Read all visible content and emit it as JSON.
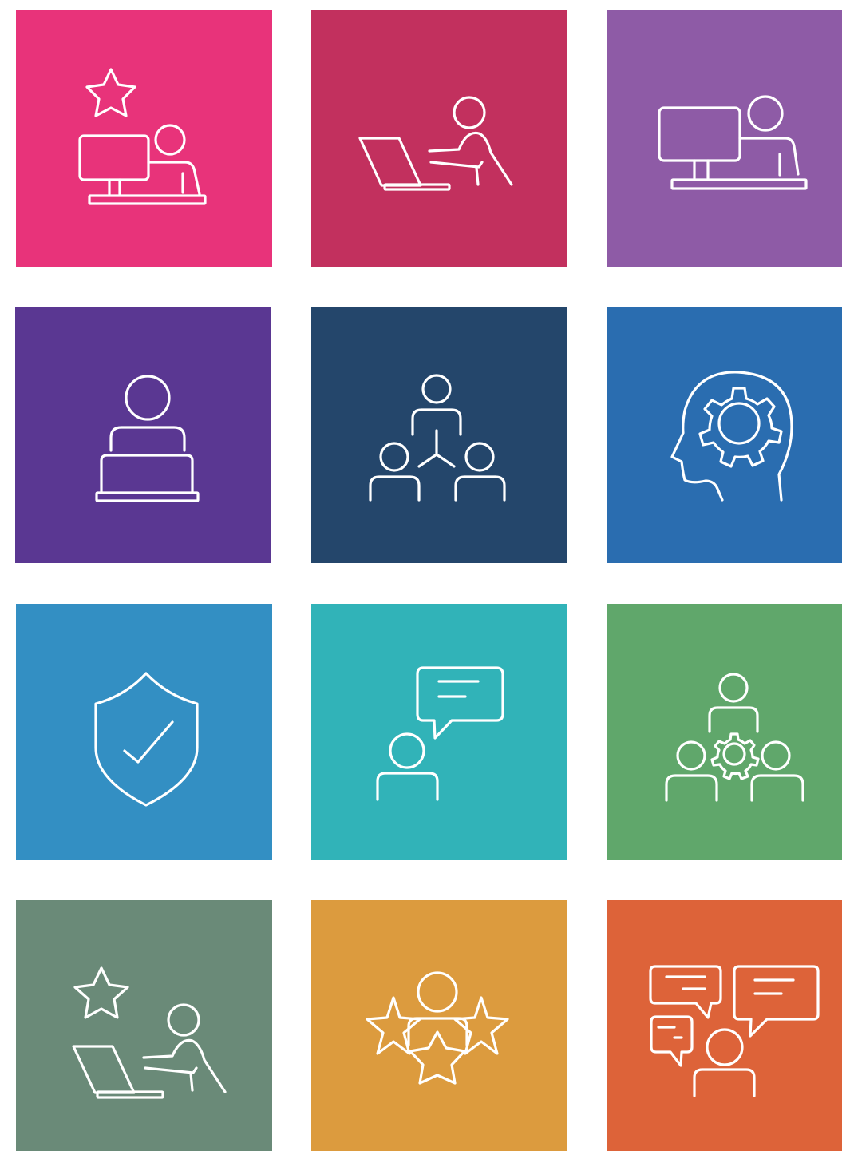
{
  "tiles": [
    {
      "icon": "person-at-desktop-with-star-icon",
      "color": "#E8337A"
    },
    {
      "icon": "person-at-laptop-icon",
      "color": "#C2305E"
    },
    {
      "icon": "person-at-desktop-icon",
      "color": "#8E5BA6"
    },
    {
      "icon": "person-behind-laptop-icon",
      "color": "#5A3792"
    },
    {
      "icon": "team-hierarchy-icon",
      "color": "#24466B"
    },
    {
      "icon": "head-with-gear-icon",
      "color": "#2A6DB0"
    },
    {
      "icon": "shield-check-icon",
      "color": "#338FC3"
    },
    {
      "icon": "person-speech-bubble-icon",
      "color": "#31B3B8"
    },
    {
      "icon": "team-gear-icon",
      "color": "#60A76B"
    },
    {
      "icon": "person-at-laptop-with-star-icon",
      "color": "#6A8A78"
    },
    {
      "icon": "person-with-stars-icon",
      "color": "#DC9B3E"
    },
    {
      "icon": "person-multiple-speech-bubbles-icon",
      "color": "#DD6339"
    }
  ]
}
